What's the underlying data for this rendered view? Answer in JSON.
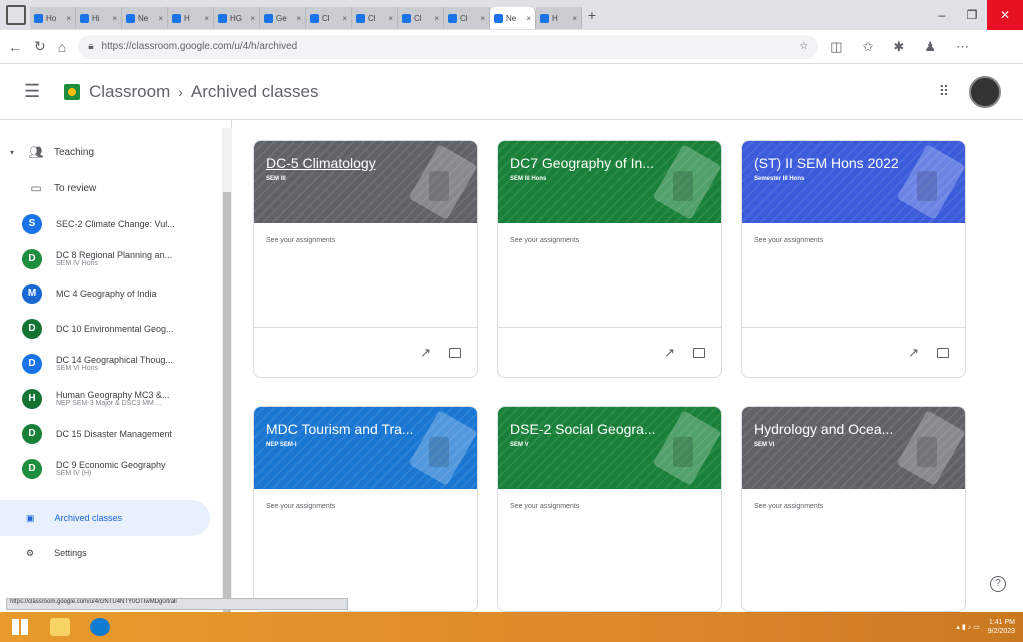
{
  "browser": {
    "tabs": [
      {
        "label": "Ho"
      },
      {
        "label": "Hi"
      },
      {
        "label": "Ne"
      },
      {
        "label": "H"
      },
      {
        "label": "HG"
      },
      {
        "label": "Ge"
      },
      {
        "label": "Cl"
      },
      {
        "label": "Cl"
      },
      {
        "label": "Cl"
      },
      {
        "label": "Cl"
      },
      {
        "label": "Ne"
      },
      {
        "label": "H"
      }
    ],
    "url": "https://classroom.google.com/u/4/h/archived"
  },
  "header": {
    "app_name": "Classroom",
    "breadcrumb_sep": "›",
    "page": "Archived classes"
  },
  "sidebar": {
    "teaching": "Teaching",
    "to_review": "To review",
    "classes": [
      {
        "initial": "S",
        "title": "SEC-2 Climate Change: Vul...",
        "subtitle": "",
        "color": "#1a73e8"
      },
      {
        "initial": "D",
        "title": "DC 8 Regional Planning an...",
        "subtitle": "SEM IV Hons",
        "color": "#1e8e3e"
      },
      {
        "initial": "M",
        "title": "MC 4 Geography of India",
        "subtitle": "",
        "color": "#1967d2"
      },
      {
        "initial": "D",
        "title": "DC 10 Environmental Geog...",
        "subtitle": "",
        "color": "#137333"
      },
      {
        "initial": "D",
        "title": "DC 14 Geographical Thoug...",
        "subtitle": "SEM VI Hons",
        "color": "#1a73e8"
      },
      {
        "initial": "H",
        "title": "Human Geography MC3 &...",
        "subtitle": "NEP SEM-3 Major & DSC3 MM ...",
        "color": "#137333"
      },
      {
        "initial": "D",
        "title": "DC 15 Disaster Management",
        "subtitle": "",
        "color": "#188038"
      },
      {
        "initial": "D",
        "title": "DC 9 Economic Geography",
        "subtitle": "SEM IV (H)",
        "color": "#1e8e3e"
      }
    ],
    "archived": "Archived classes",
    "settings": "Settings"
  },
  "cards": [
    {
      "title": "DC-5 Climatology",
      "section": "SEM III",
      "color": "#5f6368",
      "underline": true
    },
    {
      "title": "DC7 Geography of In...",
      "section": "SEM III Hons",
      "color": "#188038",
      "underline": false
    },
    {
      "title": "(ST) II SEM Hons 2022",
      "section": "Semester III Hons",
      "color": "#3b5bdb",
      "underline": false
    },
    {
      "title": "MDC Tourism and Tra...",
      "section": "NEP SEM-I",
      "color": "#1976d2",
      "underline": false
    },
    {
      "title": "DSE-2 Social Geogra...",
      "section": "SEM V",
      "color": "#188038",
      "underline": false
    },
    {
      "title": "Hydrology and Ocea...",
      "section": "SEM VI",
      "color": "#5f6368",
      "underline": false
    }
  ],
  "card_link": "See your assignments",
  "status_url": "https://classroom.google.com/u/4/c/NTU4NTY0OTIwMDg0/t/all",
  "taskbar": {
    "time": "1:41 PM",
    "date": "9/2/2023"
  }
}
